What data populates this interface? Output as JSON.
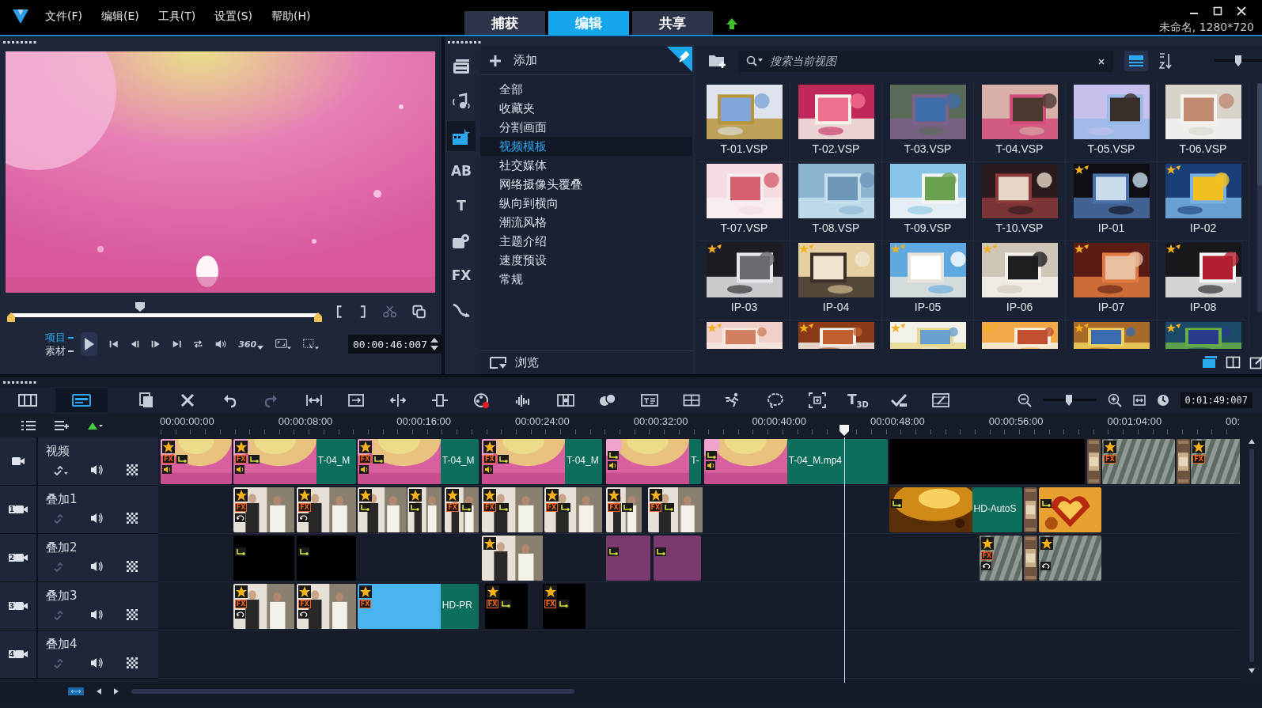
{
  "menu_bar": {
    "menus": [
      "文件(F)",
      "编辑(E)",
      "工具(T)",
      "设置(S)",
      "帮助(H)"
    ],
    "tabs": [
      {
        "label": "捕获",
        "selected": false
      },
      {
        "label": "编辑",
        "selected": true
      },
      {
        "label": "共享",
        "selected": false
      }
    ],
    "project_info": "未命名, 1280*720"
  },
  "preview": {
    "scrubber": {
      "level": 0.42
    },
    "modes": [
      {
        "label": "项目",
        "selected": true
      },
      {
        "label": "素材",
        "selected": false
      }
    ],
    "vr_label": "360",
    "timecode": "00:00:46:007"
  },
  "library": {
    "media_types": [
      {
        "selected": false
      },
      {
        "selected": false
      },
      {
        "selected": true
      },
      {
        "label": "AB",
        "selected": false
      },
      {
        "label": "T",
        "selected": false
      },
      {
        "selected": false
      },
      {
        "label": "FX",
        "selected": false
      },
      {
        "selected": false
      }
    ],
    "add_label": "添加",
    "categories": [
      {
        "label": "全部",
        "selected": false
      },
      {
        "label": "收藏夹",
        "selected": false
      },
      {
        "label": "分割画面",
        "selected": false
      },
      {
        "label": "视频模板",
        "selected": true
      },
      {
        "label": "社交媒体",
        "selected": false
      },
      {
        "label": "网络摄像头覆叠",
        "selected": false
      },
      {
        "label": "纵向到横向",
        "selected": false
      },
      {
        "label": "潮流风格",
        "selected": false
      },
      {
        "label": "主题介绍",
        "selected": false
      },
      {
        "label": "速度预设",
        "selected": false
      },
      {
        "label": "常规",
        "selected": false
      }
    ],
    "browse_label": "浏览",
    "search": {
      "placeholder": "搜索当前视图"
    },
    "list_view": {
      "selected": true
    },
    "thumb_size": {
      "level": 0.43
    },
    "thumbnails": [
      {
        "label": "T-01.VSP",
        "premium": false
      },
      {
        "label": "T-02.VSP",
        "premium": false
      },
      {
        "label": "T-03.VSP",
        "premium": false
      },
      {
        "label": "T-04.VSP",
        "premium": false
      },
      {
        "label": "T-05.VSP",
        "premium": false
      },
      {
        "label": "T-06.VSP",
        "premium": false
      },
      {
        "label": "T-07.VSP",
        "premium": false
      },
      {
        "label": "T-08.VSP",
        "premium": false
      },
      {
        "label": "T-09.VSP",
        "premium": false
      },
      {
        "label": "T-10.VSP",
        "premium": false
      },
      {
        "label": "IP-01",
        "premium": true
      },
      {
        "label": "IP-02",
        "premium": true
      },
      {
        "label": "IP-03",
        "premium": true
      },
      {
        "label": "IP-04",
        "premium": true
      },
      {
        "label": "IP-05",
        "premium": true
      },
      {
        "label": "IP-06",
        "premium": true
      },
      {
        "label": "IP-07",
        "premium": true
      },
      {
        "label": "IP-08",
        "premium": true
      },
      {
        "premium": true
      },
      {
        "premium": true
      },
      {
        "premium": true
      },
      {
        "premium": true
      },
      {
        "premium": true
      },
      {
        "premium": true
      }
    ],
    "panel_modes": [
      {
        "selected": true
      },
      {
        "selected": false
      },
      {
        "selected": false
      }
    ]
  },
  "timeline": {
    "view_buttons": [
      {
        "selected": false
      },
      {
        "selected": true
      }
    ],
    "text_3d_tool": "T$_{3D}$",
    "zoom": {
      "level": 0.49
    },
    "duration": "0:01:49:007",
    "ruler": [
      "00:00:00:00",
      "00:00:08:00",
      "00:00:16:00",
      "00:00:24:00",
      "00:00:32:00",
      "00:00:40:00",
      "00:00:48:00",
      "00:00:56:00",
      "00:01:04:00",
      "00:"
    ],
    "tracks": [
      {
        "name": "视频",
        "clips": [
          {
            "kind": "pink",
            "badges": [
              {
                "kind": "star"
              },
              {
                "kind": "fx",
                "text": "FX"
              },
              {
                "kind": "path"
              },
              {
                "kind": "audio"
              }
            ]
          },
          {
            "kind": "pink",
            "label": "T-04_M",
            "badges": [
              {
                "kind": "star"
              },
              {
                "kind": "fx",
                "text": "FX"
              },
              {
                "kind": "path"
              },
              {
                "kind": "audio"
              }
            ]
          },
          {
            "kind": "pink",
            "label": "T-04_M",
            "badges": [
              {
                "kind": "star"
              },
              {
                "kind": "fx",
                "text": "FX"
              },
              {
                "kind": "path"
              },
              {
                "kind": "audio"
              }
            ]
          },
          {
            "kind": "pink",
            "label": "T-04_M",
            "badges": [
              {
                "kind": "star"
              },
              {
                "kind": "fx",
                "text": "FX"
              },
              {
                "kind": "path"
              },
              {
                "kind": "audio"
              }
            ]
          },
          {
            "kind": "pink",
            "label": "T-",
            "badges": [
              {
                "kind": "path"
              },
              {
                "kind": "audio"
              }
            ]
          },
          {
            "kind": "pink",
            "label": "T-04_M.mp4",
            "badges": [
              {
                "kind": "path"
              },
              {
                "kind": "audio"
              }
            ]
          },
          {
            "kind": "black"
          },
          {
            "kind": "transition"
          },
          {
            "kind": "stripes",
            "badges": [
              {
                "kind": "star"
              },
              {
                "kind": "fx",
                "text": "FX"
              }
            ]
          },
          {
            "kind": "transition"
          },
          {
            "kind": "stripes",
            "badges": [
              {
                "kind": "star"
              },
              {
                "kind": "fx",
                "text": "FX"
              }
            ]
          }
        ]
      },
      {
        "name": "叠加1",
        "number": "1",
        "clips": [
          {
            "badges": [
              {
                "kind": "star"
              },
              {
                "kind": "fx",
                "text": "FX"
              },
              {
                "kind": "loop"
              }
            ]
          },
          {
            "badges": [
              {
                "kind": "star"
              },
              {
                "kind": "fx",
                "text": "FX"
              },
              {
                "kind": "loop"
              }
            ]
          },
          {
            "badges": [
              {
                "kind": "star"
              },
              {
                "kind": "path"
              }
            ]
          },
          {
            "badges": [
              {
                "kind": "star"
              },
              {
                "kind": "path"
              }
            ]
          },
          {
            "badges": [
              {
                "kind": "star"
              },
              {
                "kind": "fx",
                "text": "FX"
              },
              {
                "kind": "path"
              }
            ]
          },
          {
            "badges": [
              {
                "kind": "star"
              },
              {
                "kind": "fx",
                "text": "FX"
              },
              {
                "kind": "path"
              }
            ]
          },
          {
            "badges": [
              {
                "kind": "star"
              },
              {
                "kind": "fx",
                "text": "FX"
              },
              {
                "kind": "path"
              }
            ]
          },
          {
            "badges": [
              {
                "kind": "star"
              },
              {
                "kind": "fx",
                "text": "FX"
              },
              {
                "kind": "path"
              }
            ]
          },
          {
            "badges": [
              {
                "kind": "star"
              },
              {
                "kind": "fx",
                "text": "FX"
              },
              {
                "kind": "path"
              }
            ]
          },
          {
            "kind": "golden",
            "label": "HD-AutoS",
            "badges": [
              {
                "kind": "path"
              }
            ]
          },
          {
            "kind": "transition"
          },
          {
            "kind": "heart",
            "badges": [
              {
                "kind": "path"
              }
            ]
          }
        ]
      },
      {
        "name": "叠加2",
        "number": "2",
        "clips": [
          {
            "kind": "black",
            "badges": [
              {
                "kind": "path"
              }
            ]
          },
          {
            "kind": "black",
            "badges": [
              {
                "kind": "path"
              }
            ]
          },
          {
            "badges": [
              {
                "kind": "star"
              }
            ]
          },
          {
            "kind": "purple",
            "badges": [
              {
                "kind": "path"
              }
            ]
          },
          {
            "kind": "purple",
            "badges": [
              {
                "kind": "path"
              }
            ]
          },
          {
            "kind": "stripes",
            "badges": [
              {
                "kind": "star"
              },
              {
                "kind": "fx",
                "text": "FX"
              },
              {
                "kind": "loop"
              }
            ]
          },
          {
            "kind": "transition"
          },
          {
            "kind": "stripes",
            "badges": [
              {
                "kind": "star"
              },
              {
                "kind": "loop"
              }
            ]
          }
        ]
      },
      {
        "name": "叠加3",
        "number": "3",
        "clips": [
          {
            "badges": [
              {
                "kind": "star"
              },
              {
                "kind": "fx",
                "text": "FX"
              },
              {
                "kind": "loop"
              }
            ]
          },
          {
            "badges": [
              {
                "kind": "star"
              },
              {
                "kind": "fx",
                "text": "FX"
              },
              {
                "kind": "loop"
              }
            ]
          },
          {
            "kind": "blue",
            "label": "HD-PR",
            "badges": [
              {
                "kind": "star"
              },
              {
                "kind": "fx",
                "text": "FX"
              }
            ]
          },
          {
            "kind": "black",
            "badges": [
              {
                "kind": "star"
              },
              {
                "kind": "fx",
                "text": "FX"
              },
              {
                "kind": "path"
              }
            ]
          },
          {
            "kind": "black",
            "badges": [
              {
                "kind": "star"
              },
              {
                "kind": "fx",
                "text": "FX"
              },
              {
                "kind": "path"
              }
            ]
          }
        ]
      },
      {
        "name": "叠加4",
        "number": "4"
      }
    ]
  }
}
